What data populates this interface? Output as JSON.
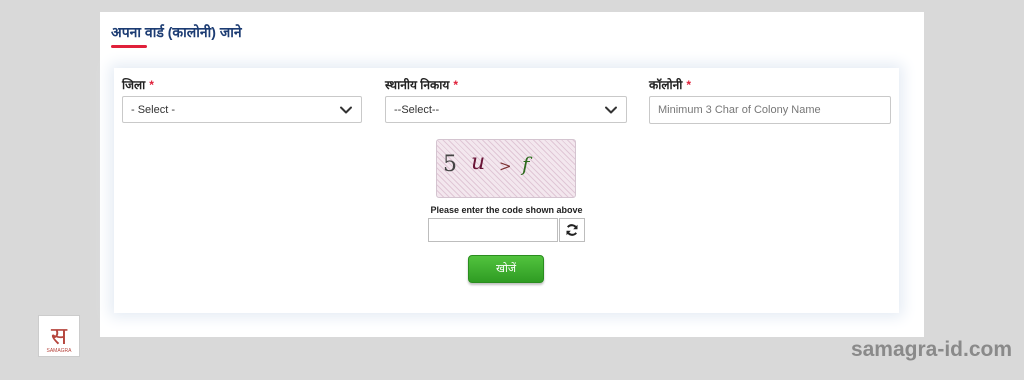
{
  "page": {
    "title": "अपना वार्ड (कालोनी) जाने"
  },
  "form": {
    "district": {
      "label": "जिला",
      "required_mark": "*",
      "selected": "- Select -"
    },
    "local_body": {
      "label": "स्थानीय निकाय",
      "required_mark": "*",
      "selected": "--Select--"
    },
    "colony": {
      "label": "कॉलोनी",
      "required_mark": "*",
      "placeholder": "Minimum 3 Char of Colony Name",
      "value": ""
    }
  },
  "captcha": {
    "chars": [
      "5",
      "u",
      ">",
      "f"
    ],
    "caption": "Please enter the code shown above",
    "input_value": ""
  },
  "search_button": {
    "label": "खोजें"
  },
  "watermark": {
    "text": "samagra-id.com"
  },
  "logo": {
    "glyph": "स",
    "subtext": "SAMAGRA"
  },
  "colors": {
    "title": "#1c3c73",
    "accent_red": "#e0203a",
    "button_green": "#3daf2f",
    "background": "#d9d9d9"
  },
  "icons": {
    "select_arrow": "chevron-down-icon",
    "captcha_refresh": "refresh-icon"
  }
}
